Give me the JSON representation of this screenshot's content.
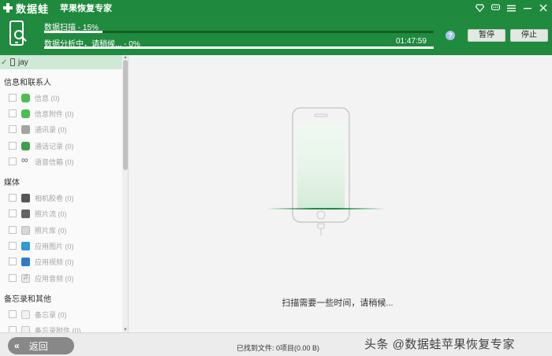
{
  "app": {
    "logo_text": "数据蛙",
    "subtitle": "苹果恢复专家",
    "window_controls": [
      "diamond-icon",
      "chat-icon",
      "menu-icon",
      "minimize-icon",
      "close-icon"
    ]
  },
  "progress": {
    "scan_label": "数据扫描 - 15%",
    "scan_fraction": 0.15,
    "analysis_label": "数据分析中，请稍候... - 0%",
    "analysis_fraction": 0.0,
    "time": "01:47:59",
    "help": "?",
    "pause_label": "暂停",
    "stop_label": "停止"
  },
  "sidebar": {
    "device_name": "jay",
    "categories": [
      {
        "title": "信息和联系人",
        "items": [
          {
            "label": "信息 (0)",
            "icon": "message-icon"
          },
          {
            "label": "信息附件 (0)",
            "icon": "message-attachment-icon"
          },
          {
            "label": "通讯录 (0)",
            "icon": "contacts-icon"
          },
          {
            "label": "通话记录 (0)",
            "icon": "call-log-icon"
          },
          {
            "label": "语音信箱 (0)",
            "icon": "voicemail-icon"
          }
        ]
      },
      {
        "title": "媒体",
        "items": [
          {
            "label": "相机胶卷 (0)",
            "icon": "camera-roll-icon"
          },
          {
            "label": "照片流 (0)",
            "icon": "photo-stream-icon"
          },
          {
            "label": "照片库 (0)",
            "icon": "photo-library-icon"
          },
          {
            "label": "应用图片 (0)",
            "icon": "app-photo-icon"
          },
          {
            "label": "应用视频 (0)",
            "icon": "app-video-icon"
          },
          {
            "label": "应用音频 (0)",
            "icon": "app-audio-icon"
          }
        ]
      },
      {
        "title": "备忘录和其他",
        "items": [
          {
            "label": "备忘录 (0)",
            "icon": "notes-icon"
          },
          {
            "label": "备忘录附件 (0)",
            "icon": "notes-attachment-icon"
          }
        ]
      }
    ]
  },
  "main": {
    "scan_message": "扫描需要一些时间，请稍候..."
  },
  "footer": {
    "back_label": "返回",
    "found_text": "已找到文件: 0项目(0.00 B)",
    "watermark": "头条 @数据蛙苹果恢复专家"
  },
  "colors": {
    "brand_green": "#1f8a3e",
    "selected_row": "#cfe9d6"
  }
}
